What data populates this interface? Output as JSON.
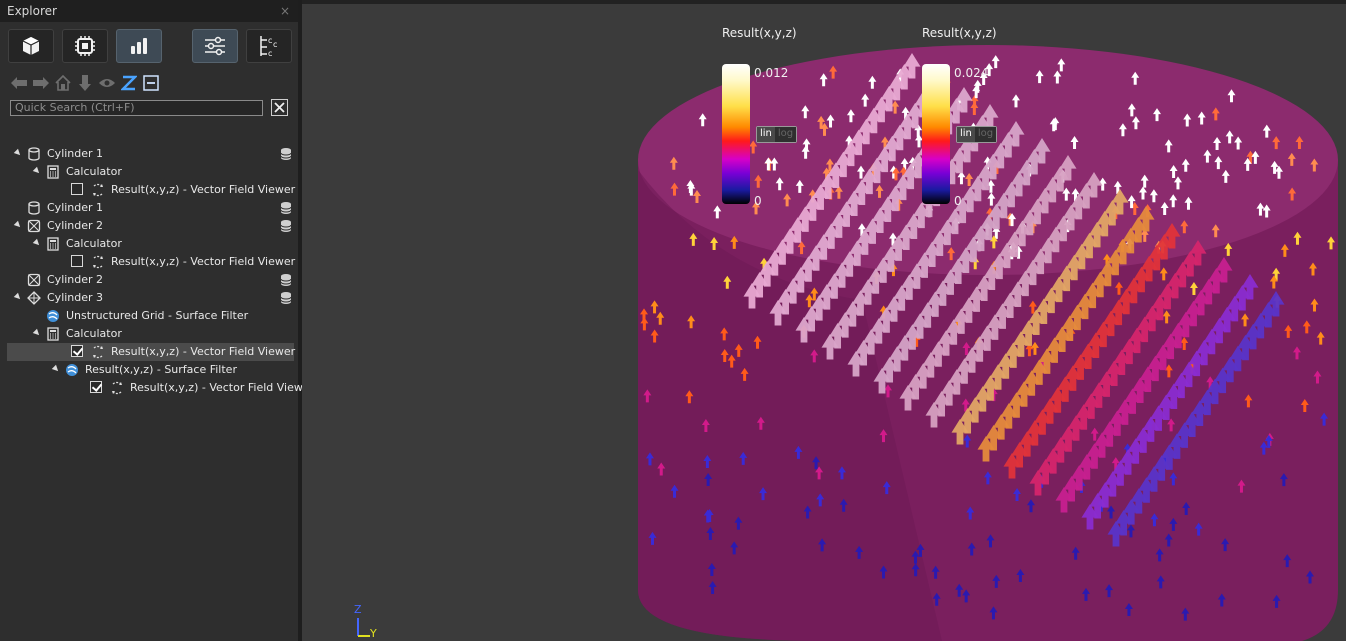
{
  "explorer": {
    "title": "Explorer",
    "close_glyph": "×",
    "mode_buttons": [
      {
        "icon": "cube-icon",
        "active": false
      },
      {
        "icon": "chip-icon",
        "active": false
      },
      {
        "icon": "bar-chart-icon",
        "active": true
      },
      {
        "icon": "sliders-icon",
        "active": true
      },
      {
        "icon": "hierarchy-icon",
        "active": false
      }
    ],
    "nav_buttons": [
      "arrow-left-icon",
      "arrow-right-icon",
      "home-icon",
      "arrow-down-icon",
      "eye-icon",
      "z-axis-icon",
      "collapse-icon"
    ],
    "search": {
      "placeholder": "Quick Search (Ctrl+F)"
    },
    "tree": [
      {
        "label": "Cylinder 1",
        "depth": 0,
        "twisty": true,
        "icon": "cylinder-icon",
        "checkbox": null,
        "db": true
      },
      {
        "label": "Calculator",
        "depth": 1,
        "twisty": true,
        "icon": "calculator-icon",
        "checkbox": null,
        "db": false
      },
      {
        "label": "Result(x,y,z) - Vector Field Viewer",
        "depth": 2,
        "twisty": false,
        "icon": "vector-field-icon",
        "checkbox": false,
        "db": false
      },
      {
        "label": "Cylinder 1",
        "depth": 0,
        "twisty": false,
        "icon": "cylinder-icon",
        "checkbox": null,
        "db": true
      },
      {
        "label": "Cylinder 2",
        "depth": 0,
        "twisty": true,
        "icon": "mesh-cylinder-icon",
        "checkbox": null,
        "db": true
      },
      {
        "label": "Calculator",
        "depth": 1,
        "twisty": true,
        "icon": "calculator-icon",
        "checkbox": null,
        "db": false
      },
      {
        "label": "Result(x,y,z) - Vector Field Viewer",
        "depth": 2,
        "twisty": false,
        "icon": "vector-field-icon",
        "checkbox": false,
        "db": false
      },
      {
        "label": "Cylinder 2",
        "depth": 0,
        "twisty": false,
        "icon": "mesh-cylinder-icon",
        "checkbox": null,
        "db": true
      },
      {
        "label": "Cylinder 3",
        "depth": 0,
        "twisty": true,
        "icon": "diamond-grid-icon",
        "checkbox": null,
        "db": true
      },
      {
        "label": "Unstructured Grid - Surface Filter",
        "depth": 1,
        "twisty": false,
        "icon": "surface-filter-icon",
        "checkbox": null,
        "db": false
      },
      {
        "label": "Calculator",
        "depth": 1,
        "twisty": true,
        "icon": "calculator-icon",
        "checkbox": null,
        "db": false
      },
      {
        "label": "Result(x,y,z) - Vector Field Viewer",
        "depth": 2,
        "twisty": false,
        "icon": "vector-field-icon",
        "checkbox": true,
        "db": false,
        "selected": true
      },
      {
        "label": "Result(x,y,z) - Surface Filter",
        "depth": 2,
        "twisty": true,
        "icon": "surface-filter-icon",
        "checkbox": null,
        "db": false
      },
      {
        "label": "Result(x,y,z) - Vector Field Viewer",
        "depth": 3,
        "twisty": false,
        "icon": "vector-field-icon",
        "checkbox": true,
        "db": false
      }
    ]
  },
  "viewport": {
    "legends": [
      {
        "title": "Result(x,y,z)",
        "max": "0.012",
        "min": "0",
        "scale_on": "lin",
        "scale_off": "log"
      },
      {
        "title": "Result(x,y,z)",
        "max": "0.024",
        "min": "0",
        "scale_on": "lin",
        "scale_off": "log"
      }
    ],
    "axes": {
      "z": "Z",
      "y": "Y"
    },
    "colors": {
      "cylinder": "#7a1f5e",
      "cylinder_top": "#8c2b6e",
      "background": "#3b3b3b",
      "bands": [
        "#e8a9d2",
        "#e0a9d0",
        "#dca6cc",
        "#d9a5c9",
        "#d7a4c8",
        "#d4a3c6",
        "#d7a0c2",
        "#d6a0c0",
        "#e2a565",
        "#e58a3c",
        "#e0333a",
        "#d5256c",
        "#c7208f",
        "#8a2cd0",
        "#5a34c8"
      ]
    }
  }
}
